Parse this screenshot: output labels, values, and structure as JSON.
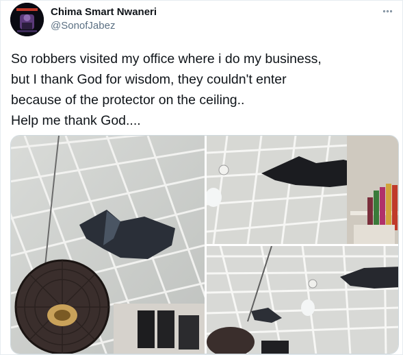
{
  "author": {
    "name": "Chima Smart Nwaneri",
    "handle": "@SonofJabez"
  },
  "tweet": {
    "lines": [
      "So robbers visited my office where i do my business,",
      "but I thank God for wisdom, they couldn't enter",
      "because of the protector on the ceiling..",
      "Help me thank God...."
    ]
  },
  "media": {
    "photos": [
      {
        "description_name": "ceiling-hole-with-fan"
      },
      {
        "description_name": "ceiling-hole-with-shelf"
      },
      {
        "description_name": "ceiling-grid-wide"
      }
    ]
  },
  "icons": {
    "more": "more-options-icon"
  }
}
